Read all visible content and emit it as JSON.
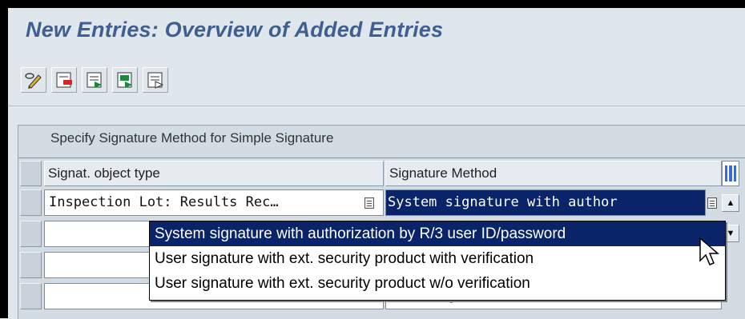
{
  "page": {
    "title": "New Entries: Overview of Added Entries"
  },
  "toolbar": {
    "buttons": [
      {
        "icon": "display-change-icon"
      },
      {
        "icon": "delete-row-icon"
      },
      {
        "icon": "select-all-icon"
      },
      {
        "icon": "select-block-icon"
      },
      {
        "icon": "deselect-all-icon"
      }
    ]
  },
  "table": {
    "caption": "Specify Signature Method for Simple Signature",
    "columns": [
      "Signat. object type",
      "Signature Method"
    ],
    "rows": [
      {
        "object_type": "Inspection Lot: Results Rec…",
        "method": "System signature with author"
      },
      {
        "object_type": "",
        "method": ""
      },
      {
        "object_type": "",
        "method": ""
      },
      {
        "object_type": "",
        "method": "User signature with ext. se…"
      }
    ]
  },
  "dropdown": {
    "options": [
      "System signature with authorization by R/3 user ID/password",
      "User signature with ext. security product with verification",
      "User signature with ext. security product w/o verification"
    ],
    "selected_index": 0
  },
  "colors": {
    "title": "#3f5f93",
    "selection": "#0a246a",
    "background": "#dfe6ec"
  }
}
